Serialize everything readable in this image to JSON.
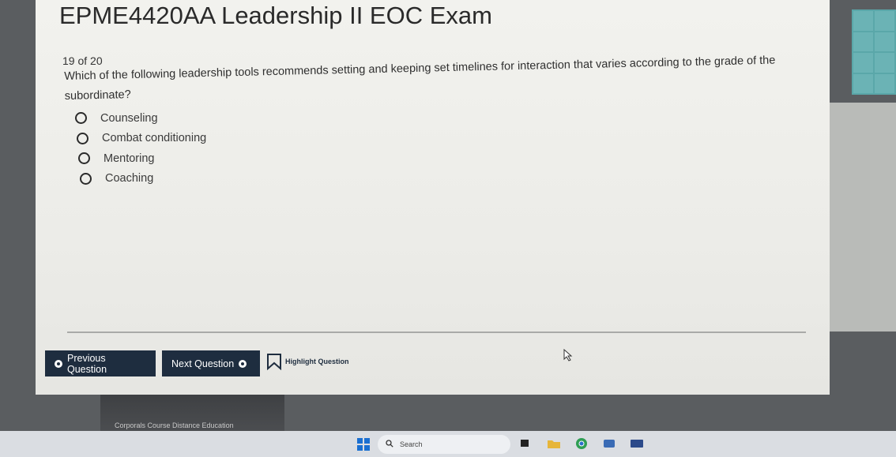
{
  "exam": {
    "title": "EPME4420AA Leadership II EOC Exam",
    "counter": "19  of 20",
    "question": "Which of the following leadership tools recommends setting and keeping set timelines for interaction that varies according to the grade of the subordinate?",
    "options": [
      {
        "label": "Counseling"
      },
      {
        "label": "Combat conditioning"
      },
      {
        "label": "Mentoring"
      },
      {
        "label": "Coaching"
      }
    ]
  },
  "nav": {
    "previous_label": "Previous Question",
    "next_label": "Next Question",
    "highlight_label": "Highlight Question"
  },
  "footer": {
    "banner_text": "Corporals Course Distance Education"
  },
  "taskbar": {
    "search_label": "Search",
    "icons": [
      "windows-start-icon",
      "search-icon",
      "task-view-icon",
      "file-explorer-icon",
      "chrome-icon",
      "xbox-icon",
      "app-icon"
    ]
  },
  "colors": {
    "button_bg": "#1e2d3f",
    "side_panel": "#5aa7a9",
    "card_bg": "#f2f2ee"
  }
}
